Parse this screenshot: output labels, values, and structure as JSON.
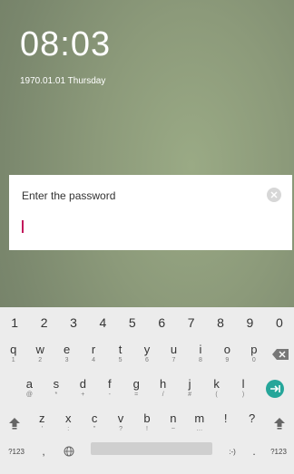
{
  "lockscreen": {
    "time": "08:03",
    "date": "1970.01.01  Thursday"
  },
  "password_dialog": {
    "label": "Enter the password",
    "clear_icon": "clear-circle-icon",
    "input_value": ""
  },
  "keyboard": {
    "number_row": [
      "1",
      "2",
      "3",
      "4",
      "5",
      "6",
      "7",
      "8",
      "9",
      "0"
    ],
    "row1": [
      {
        "main": "q",
        "sub": "1"
      },
      {
        "main": "w",
        "sub": "2"
      },
      {
        "main": "e",
        "sub": "3"
      },
      {
        "main": "r",
        "sub": "4"
      },
      {
        "main": "t",
        "sub": "5"
      },
      {
        "main": "y",
        "sub": "6"
      },
      {
        "main": "u",
        "sub": "7"
      },
      {
        "main": "i",
        "sub": "8"
      },
      {
        "main": "o",
        "sub": "9"
      },
      {
        "main": "p",
        "sub": "0"
      }
    ],
    "row2": [
      {
        "main": "a",
        "sub": "@"
      },
      {
        "main": "s",
        "sub": "*"
      },
      {
        "main": "d",
        "sub": "+"
      },
      {
        "main": "f",
        "sub": "-"
      },
      {
        "main": "g",
        "sub": "="
      },
      {
        "main": "h",
        "sub": "/"
      },
      {
        "main": "j",
        "sub": "#"
      },
      {
        "main": "k",
        "sub": "("
      },
      {
        "main": "l",
        "sub": ")"
      }
    ],
    "row3": [
      {
        "main": "z",
        "sub": "'"
      },
      {
        "main": "x",
        "sub": ":"
      },
      {
        "main": "c",
        "sub": "\""
      },
      {
        "main": "v",
        "sub": "?"
      },
      {
        "main": "b",
        "sub": "!"
      },
      {
        "main": "n",
        "sub": "~"
      },
      {
        "main": "m",
        "sub": "…"
      }
    ],
    "row3_extra": [
      "!",
      "?"
    ],
    "bottom": {
      "symbols_left": "?123",
      "comma": ",",
      "emoji": ":-)",
      "period": ".",
      "symbols_right": "?123"
    },
    "colors": {
      "enter": "#26a69a"
    }
  }
}
